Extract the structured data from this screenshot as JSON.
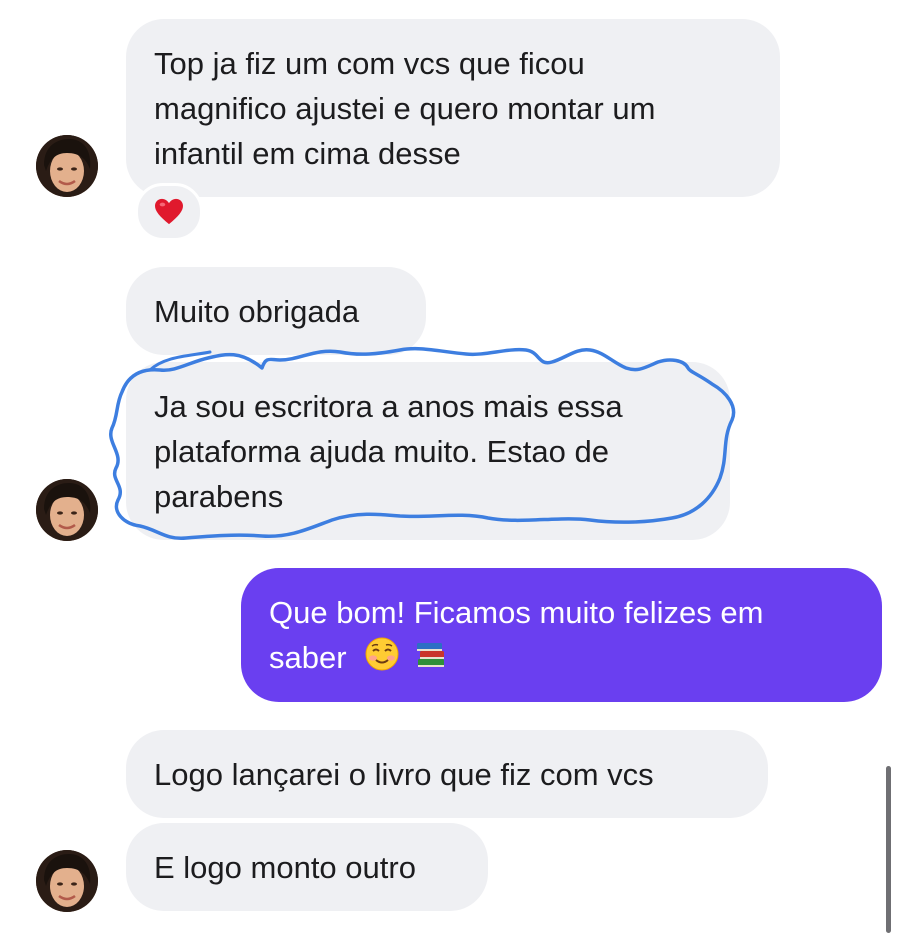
{
  "messages": [
    {
      "id": "m1",
      "direction": "incoming",
      "text": "Top ja fiz um com vcs que ficou\nmagnifico ajustei e quero montar um\ninfantil em cima desse",
      "reaction": "heart"
    },
    {
      "id": "m2",
      "direction": "incoming",
      "text": "Muito obrigada"
    },
    {
      "id": "m3",
      "direction": "incoming",
      "text": "Ja sou escritora a anos mais essa\nplataforma ajuda muito. Estao de\nparabens",
      "highlighted": true
    },
    {
      "id": "m4",
      "direction": "outgoing",
      "text_line1": "Que bom! Ficamos muito felizes em",
      "text_line2": "saber",
      "emojis": [
        "smiling-face-icon",
        "books-icon"
      ]
    },
    {
      "id": "m5",
      "direction": "incoming",
      "text": "Logo lançarei o livro que fiz com vcs"
    },
    {
      "id": "m6",
      "direction": "incoming",
      "text": "E logo monto outro"
    }
  ],
  "colors": {
    "incoming_bubble": "#eff0f3",
    "outgoing_bubble": "#6a3ff0",
    "annotation": "#3d7ee0",
    "reaction_heart": "#e0192d"
  }
}
